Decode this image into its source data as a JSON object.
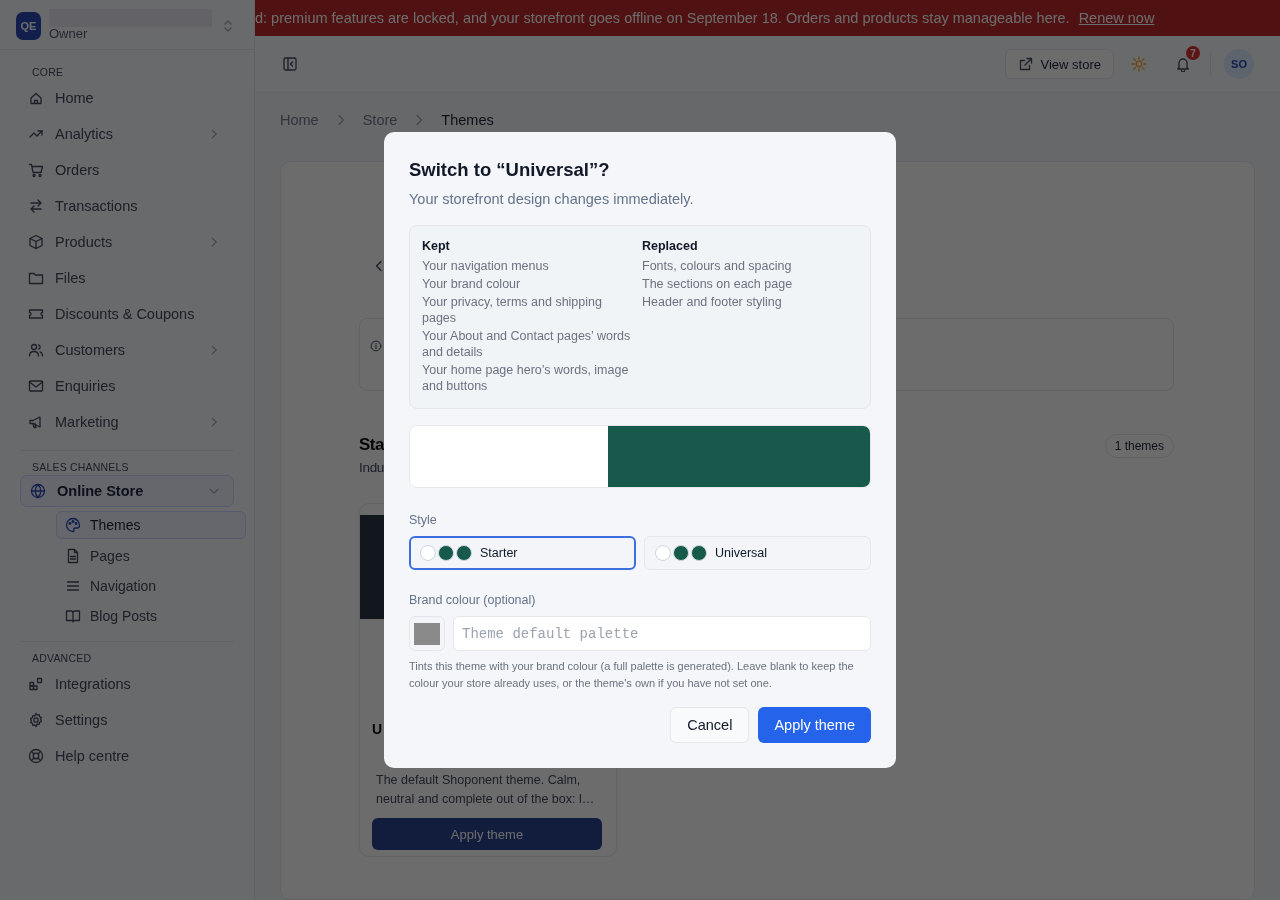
{
  "banner": {
    "message": "d: premium features are locked, and your storefront goes offline on September 18. Orders and products stay manageable here.",
    "link": "Renew now"
  },
  "sidebar": {
    "store": {
      "initials": "QE",
      "role": "Owner"
    },
    "sections": [
      {
        "label": "CORE",
        "items": [
          {
            "label": "Home",
            "selected": false
          },
          {
            "label": "Analytics",
            "selected": false,
            "expanded": false
          },
          {
            "label": "Orders",
            "selected": false
          },
          {
            "label": "Transactions",
            "selected": false
          },
          {
            "label": "Products",
            "selected": false,
            "expanded": false
          },
          {
            "label": "Files",
            "selected": false
          },
          {
            "label": "Discounts & Coupons",
            "selected": false
          },
          {
            "label": "Customers",
            "selected": false,
            "expanded": false
          },
          {
            "label": "Enquiries",
            "selected": false
          },
          {
            "label": "Marketing",
            "selected": false,
            "expanded": false
          }
        ]
      },
      {
        "label": "SALES CHANNELS",
        "items": [
          {
            "label": "Online Store",
            "selected": true,
            "expanded": true,
            "children": [
              {
                "label": "Themes",
                "selected": true
              },
              {
                "label": "Pages",
                "selected": false
              },
              {
                "label": "Navigation",
                "selected": false
              },
              {
                "label": "Blog Posts",
                "selected": false
              }
            ]
          }
        ]
      },
      {
        "label": "ADVANCED",
        "items": [
          {
            "label": "Integrations",
            "selected": false
          },
          {
            "label": "Settings",
            "selected": false
          },
          {
            "label": "Help centre",
            "selected": false
          }
        ]
      }
    ]
  },
  "header": {
    "view_store": "View store",
    "notification_count": "7",
    "avatar": "SO"
  },
  "breadcrumb": [
    {
      "label": "Home",
      "current": false
    },
    {
      "label": "Store",
      "current": false
    },
    {
      "label": "Themes",
      "current": true
    }
  ],
  "content": {
    "heading": "Sta",
    "subheading": "Indu",
    "count_badge": "1 themes",
    "theme_card": {
      "title": "U",
      "description": "The default Shoponent theme. Calm, neutral and complete out of the box: l…",
      "button": "Apply theme"
    }
  },
  "modal": {
    "title": "Switch to “Universal”?",
    "subtitle": "Your storefront design changes immediately.",
    "kept": {
      "heading": "Kept",
      "items": [
        "Your navigation menus",
        "Your brand colour",
        "Your privacy, terms and shipping pages",
        "Your About and Contact pages’ words and details",
        "Your home page hero’s words, image and buttons"
      ]
    },
    "replaced": {
      "heading": "Replaced",
      "items": [
        "Fonts, colours and spacing",
        "The sections on each page",
        "Header and footer styling"
      ]
    },
    "style": {
      "label": "Style",
      "options": [
        {
          "name": "Starter",
          "selected": true,
          "swatches": [
            {
              "color": "#ffffff"
            },
            {
              "color": "#17594a"
            },
            {
              "color": "#17594a"
            }
          ]
        },
        {
          "name": "Universal",
          "selected": false,
          "swatches": [
            {
              "color": "#ffffff"
            },
            {
              "color": "#17594a"
            },
            {
              "color": "#17594a"
            }
          ]
        }
      ]
    },
    "brand_colour": {
      "label": "Brand colour (optional)",
      "placeholder": "Theme default palette",
      "help": "Tints this theme with your brand colour (a full palette is generated). Leave blank to keep the colour your store already uses, or the theme's own if you have not set one."
    },
    "buttons": [
      {
        "label": "Cancel",
        "kind": "secondary"
      },
      {
        "label": "Apply theme",
        "kind": "primary"
      }
    ]
  }
}
